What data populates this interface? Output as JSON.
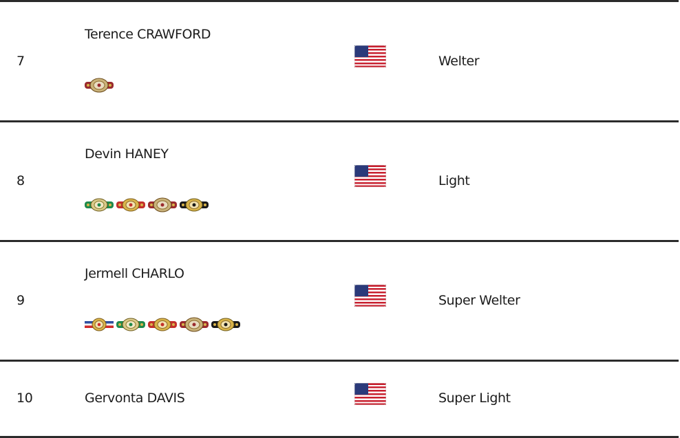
{
  "rankings": [
    {
      "rank": "7",
      "name": "Terence CRAWFORD",
      "country_flag": "us-flag-icon",
      "division": "Welter",
      "belts": [
        "wbo-belt-icon"
      ]
    },
    {
      "rank": "8",
      "name": "Devin HANEY",
      "country_flag": "us-flag-icon",
      "division": "Light",
      "belts": [
        "wbc-belt-icon",
        "ibf-belt-icon",
        "wbo-belt-icon",
        "wba-belt-icon"
      ]
    },
    {
      "rank": "9",
      "name": "Jermell CHARLO",
      "country_flag": "us-flag-icon",
      "division": "Super Welter",
      "belts": [
        "ring-belt-icon",
        "wbc-belt-icon",
        "ibf-belt-icon",
        "wbo-belt-icon",
        "wba-belt-icon"
      ]
    },
    {
      "rank": "10",
      "name": "Gervonta DAVIS",
      "country_flag": "us-flag-icon",
      "division": "Super Light",
      "belts": []
    }
  ],
  "colors": {
    "divider": "#2b2b2b",
    "text": "#1c1c1c",
    "wbc_green": "#1f8a4c",
    "ibf_red": "#c4302b",
    "wbo_maroon": "#9a2a2e",
    "wba_black": "#1a1a1a",
    "ring_stripe_blue": "#2d4fa0",
    "ring_stripe_red": "#d12a2a",
    "gold": "#d9b44a"
  }
}
